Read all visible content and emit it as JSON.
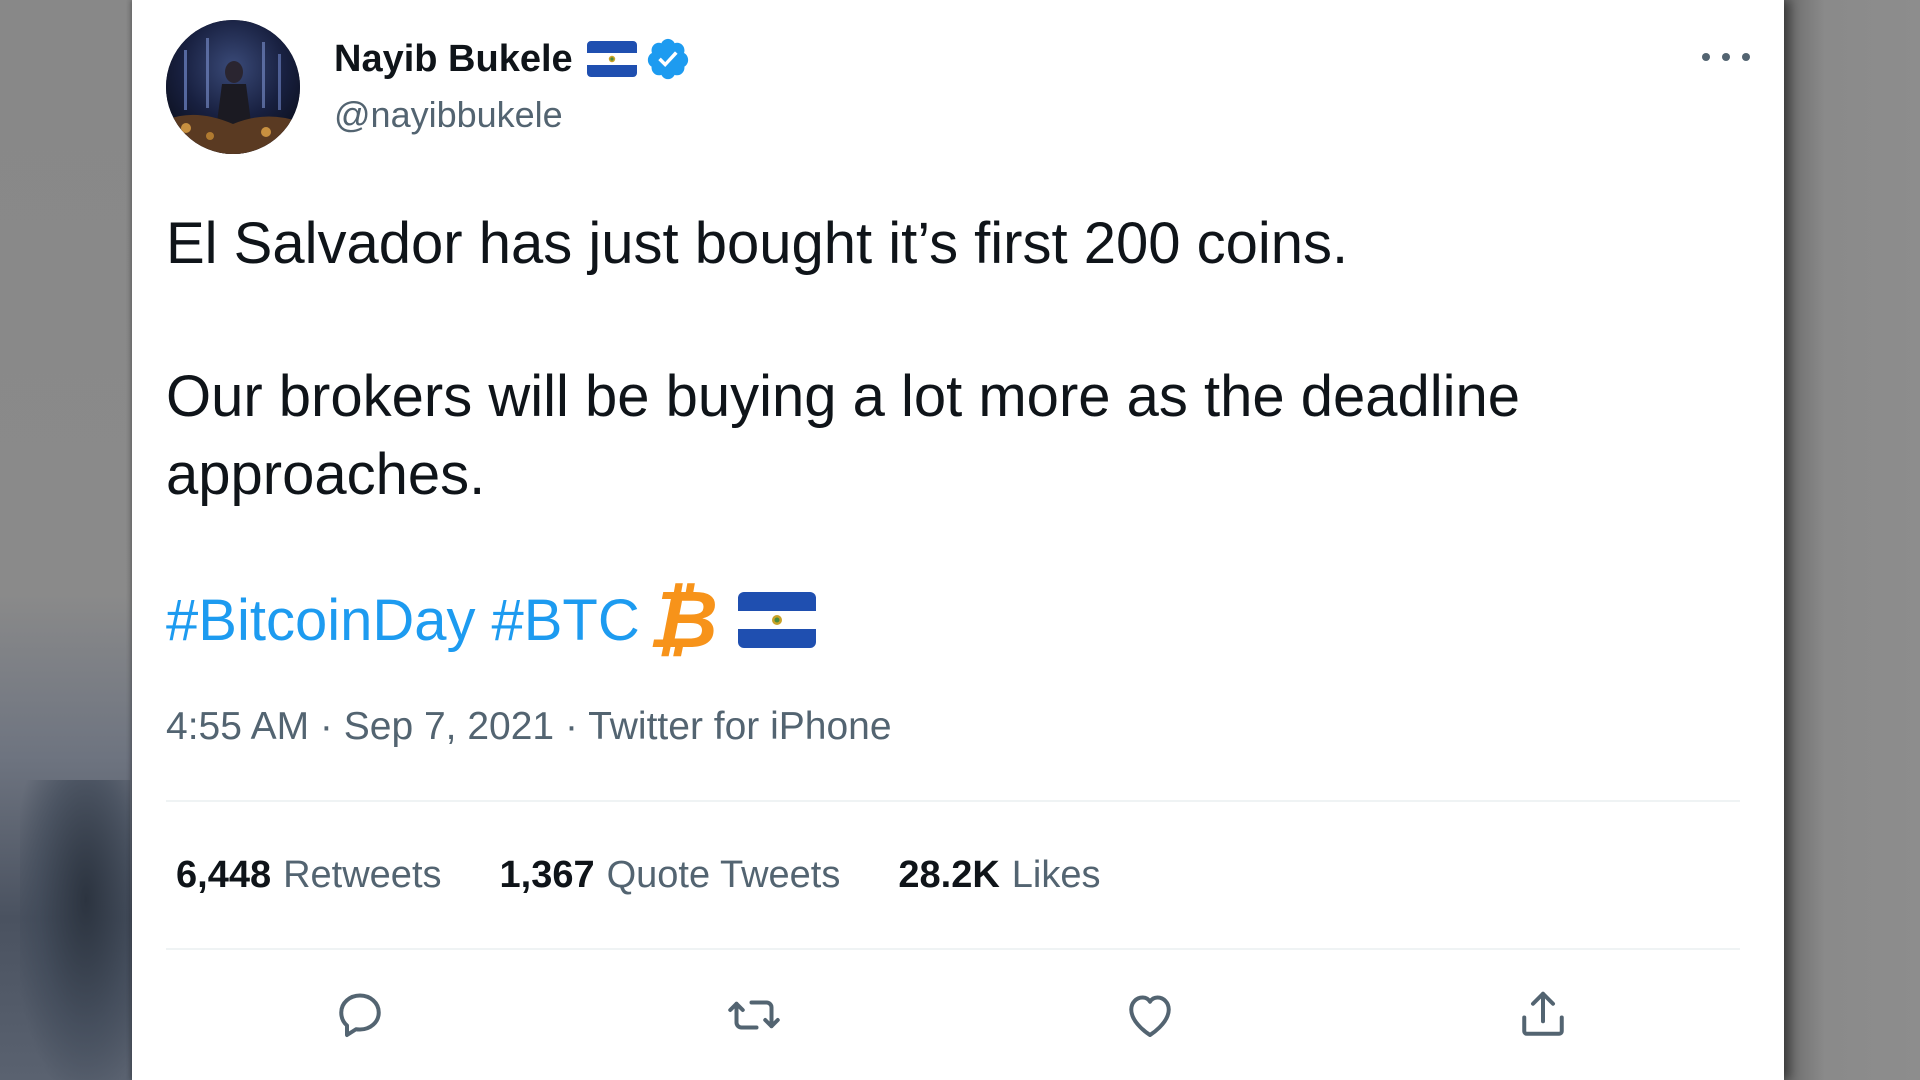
{
  "tweet": {
    "author": {
      "display_name": "Nayib Bukele",
      "handle": "@nayibbukele",
      "verified": true,
      "flag_icon": "el-salvador-flag-icon"
    },
    "text": {
      "paragraph_1": "El Salvador has just bought it’s first 200 coins.",
      "paragraph_2": "Our brokers will be buying a lot more as the deadline approaches."
    },
    "hashtags": [
      "#BitcoinDay",
      "#BTC"
    ],
    "emoji": [
      "bitcoin-icon",
      "el-salvador-flag-icon"
    ],
    "bitcoin_symbol": "₿",
    "meta": {
      "time": "4:55 AM",
      "separator": " · ",
      "date": "Sep 7, 2021",
      "source": "Twitter for iPhone"
    },
    "stats": {
      "retweets": {
        "count": "6,448",
        "label": "Retweets"
      },
      "quote_tweets": {
        "count": "1,367",
        "label": "Quote Tweets"
      },
      "likes": {
        "count": "28.2K",
        "label": "Likes"
      }
    },
    "actions": [
      "reply-icon",
      "retweet-icon",
      "like-icon",
      "share-icon"
    ]
  },
  "colors": {
    "text_primary": "#0f1419",
    "text_secondary": "#536471",
    "link": "#1d9bf0",
    "verified": "#1d9bf0",
    "bitcoin": "#f7931a",
    "flag_blue": "#1f4fb0"
  }
}
